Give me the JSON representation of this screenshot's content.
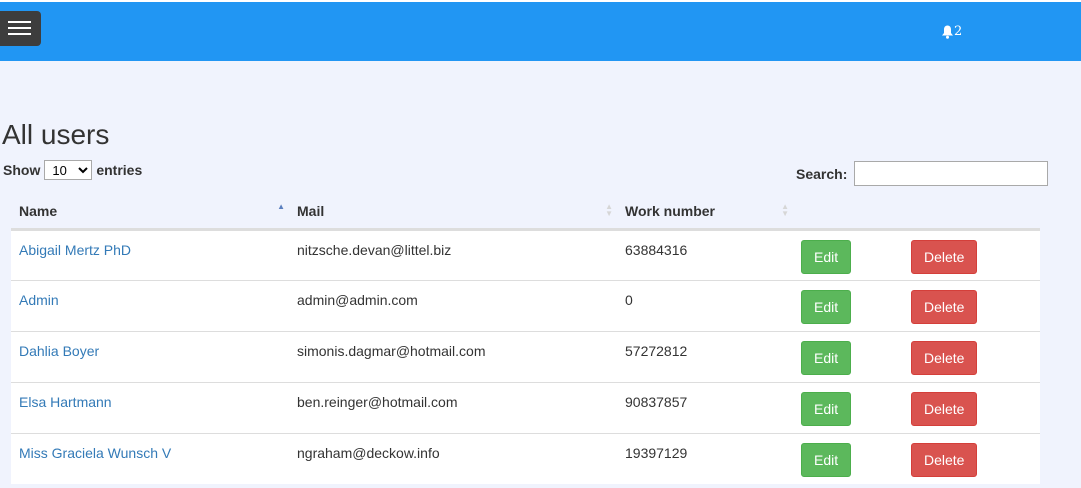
{
  "nav": {
    "menu_icon": "hamburger-icon",
    "notification_icon": "bell-icon",
    "notification_count": "2",
    "colors": {
      "bar": "#2196f3",
      "menu_button": "#3d3d3d"
    }
  },
  "page": {
    "title": "All users"
  },
  "table_controls": {
    "show_label": "Show",
    "entries_value": "10",
    "entries_label": "entries",
    "search_label": "Search:",
    "search_value": ""
  },
  "table": {
    "columns": [
      "Name",
      "Mail",
      "Work number"
    ],
    "sorted_column": "Name",
    "sort_direction": "ascending",
    "rows": [
      {
        "name": "Abigail Mertz PhD",
        "mail": "nitzsche.devan@littel.biz",
        "work_number": "63884316",
        "edit": "Edit",
        "delete": "Delete"
      },
      {
        "name": "Admin",
        "mail": "admin@admin.com",
        "work_number": "0",
        "edit": "Edit",
        "delete": "Delete"
      },
      {
        "name": "Dahlia Boyer",
        "mail": "simonis.dagmar@hotmail.com",
        "work_number": "57272812",
        "edit": "Edit",
        "delete": "Delete"
      },
      {
        "name": "Elsa Hartmann",
        "mail": "ben.reinger@hotmail.com",
        "work_number": "90837857",
        "edit": "Edit",
        "delete": "Delete"
      },
      {
        "name": "Miss Graciela Wunsch V",
        "mail": "ngraham@deckow.info",
        "work_number": "19397129",
        "edit": "Edit",
        "delete": "Delete"
      }
    ],
    "colors": {
      "edit": "#5cb85c",
      "delete": "#d9534f",
      "link": "#337ab7"
    }
  }
}
